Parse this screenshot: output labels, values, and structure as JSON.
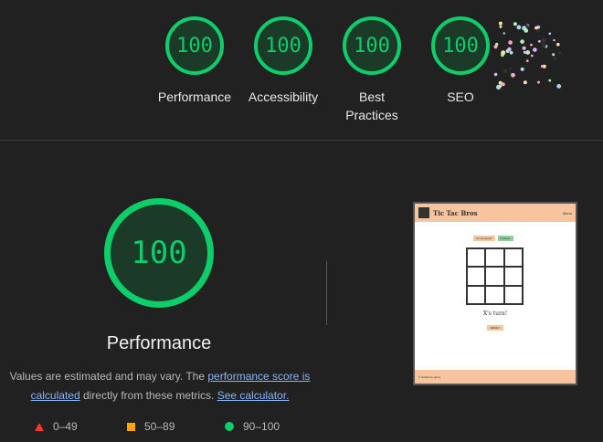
{
  "summary": [
    {
      "score": "100",
      "label": "Performance"
    },
    {
      "score": "100",
      "label": "Accessibility"
    },
    {
      "score": "100",
      "label": "Best Practices"
    },
    {
      "score": "100",
      "label": "SEO"
    }
  ],
  "main": {
    "score": "100",
    "title": "Performance",
    "note_pre": "Values are estimated and may vary. The ",
    "note_link1": "performance score is calculated",
    "note_mid": " directly from these metrics. ",
    "note_link2": "See calculator."
  },
  "legend": [
    {
      "range": "0–49",
      "color": "#ff3333"
    },
    {
      "range": "50–89",
      "color": "#ffa400"
    },
    {
      "range": "90–100",
      "color": "#0cce6b"
    }
  ],
  "screenshot": {
    "title": "Tic Tac Bros",
    "menu": "Menu",
    "mode1": "Vs Computer",
    "mode2": "2 Player",
    "turn": "X's turn!",
    "reset": "RESET",
    "footer": "© tictacbros game"
  },
  "colors": {
    "pass": "#0cce6b",
    "average": "#ffa400",
    "fail": "#ff3333"
  }
}
